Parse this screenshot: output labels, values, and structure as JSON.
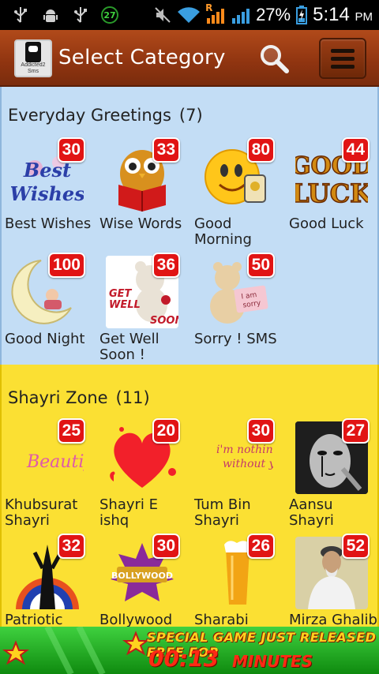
{
  "status_bar": {
    "icons": [
      "usb-icon",
      "android-debug-icon",
      "usb-icon",
      "badge-27-icon",
      "mute-icon",
      "wifi-icon",
      "roaming-signal-icon",
      "signal-icon",
      "battery-icon"
    ],
    "notification_badge": "27",
    "roaming_letter": "R",
    "battery_percent": "27%",
    "time": "5:14",
    "ampm": "PM"
  },
  "header": {
    "app_icon_label": "Addicted2 Sms",
    "title": "Select Category",
    "search_icon": "search-icon",
    "menu_icon": "hamburger-menu-icon"
  },
  "sections": [
    {
      "title": "Everyday Greetings",
      "count": "(7)",
      "color": "#c3ddf5",
      "items": [
        {
          "label": "Best Wishes",
          "count": "30",
          "icon": "best-wishes-icon"
        },
        {
          "label": "Wise Words",
          "count": "33",
          "icon": "owl-book-icon"
        },
        {
          "label": "Good Morning",
          "count": "80",
          "icon": "smiley-coffee-icon"
        },
        {
          "label": "Good Luck",
          "count": "44",
          "icon": "good-luck-icon"
        },
        {
          "label": "Good Night",
          "count": "100",
          "icon": "moon-icon"
        },
        {
          "label": "Get Well Soon !",
          "count": "36",
          "icon": "get-well-bear-icon"
        },
        {
          "label": "Sorry ! SMS",
          "count": "50",
          "icon": "sorry-bear-icon"
        }
      ]
    },
    {
      "title": "Shayri Zone",
      "count": "(11)",
      "color": "#fbe033",
      "items": [
        {
          "label": "Khubsurat Shayri",
          "count": "25",
          "icon": "beautiful-text-icon"
        },
        {
          "label": "Shayri E ishq",
          "count": "20",
          "icon": "heart-icon"
        },
        {
          "label": "Tum Bin Shayri",
          "count": "30",
          "icon": "im-nothing-without-you-icon"
        },
        {
          "label": "Aansu Shayri",
          "count": "27",
          "icon": "crying-face-icon"
        },
        {
          "label": "Patriotic Shayri",
          "count": "32",
          "icon": "patriotic-silhouette-icon"
        },
        {
          "label": "Bollywood Shayri",
          "count": "30",
          "icon": "bollywood-icon"
        },
        {
          "label": "Sharabi Shayri",
          "count": "26",
          "icon": "beer-glass-icon"
        },
        {
          "label": "Mirza Ghalib",
          "count": "52",
          "icon": "mirza-ghalib-icon"
        }
      ]
    }
  ],
  "ad_banner": {
    "line1": "SPECIAL GAME JUST RELEASED FREE FOR",
    "timer": "00:13",
    "unit": "MINUTES"
  }
}
